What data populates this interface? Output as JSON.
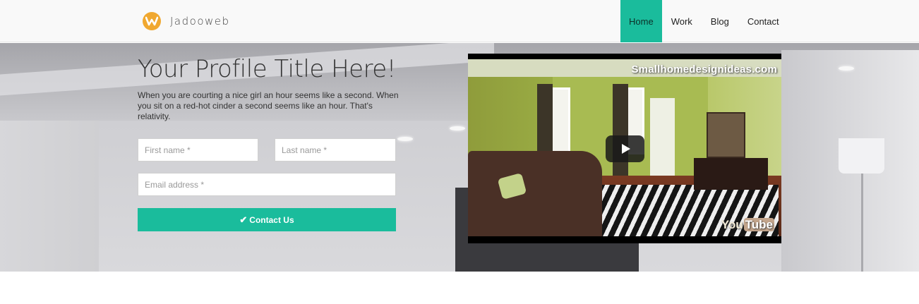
{
  "brand": {
    "name": "Jadooweb",
    "logo_letter": "W",
    "logo_color": "#f0a830"
  },
  "nav": {
    "items": [
      {
        "label": "Home",
        "active": true
      },
      {
        "label": "Work",
        "active": false
      },
      {
        "label": "Blog",
        "active": false
      },
      {
        "label": "Contact",
        "active": false
      }
    ],
    "accent": "#1abc9c"
  },
  "hero": {
    "title": "Your Profile Title Here!",
    "text": "When you are courting a nice girl an hour seems like a second. When you sit on a red-hot cinder a second seems like an hour. That's relativity."
  },
  "form": {
    "first_name_placeholder": "First name *",
    "last_name_placeholder": "Last name *",
    "email_placeholder": "Email address *",
    "submit_label": "Contact Us",
    "submit_icon": "check-icon"
  },
  "video": {
    "watermark": "Smallhomedesignideas.com",
    "yt_logo_you": "You",
    "yt_logo_tube": "Tube",
    "play_icon": "play-icon"
  }
}
